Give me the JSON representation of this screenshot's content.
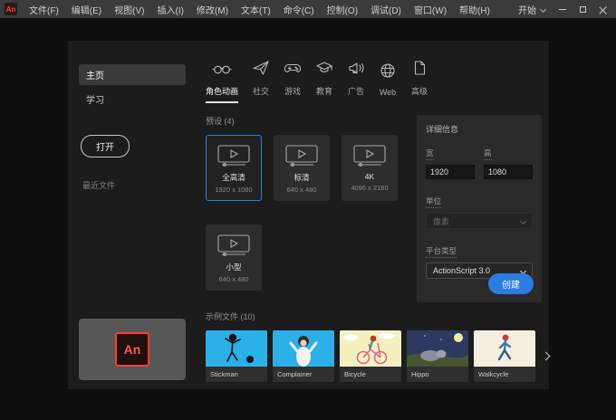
{
  "titlebar": {
    "app_icon_text": "An",
    "menus": [
      "文件(F)",
      "编辑(E)",
      "视图(V)",
      "插入(I)",
      "修改(M)",
      "文本(T)",
      "命令(C)",
      "控制(O)",
      "调试(D)",
      "窗口(W)",
      "帮助(H)"
    ],
    "workspace_label": "开始"
  },
  "sidebar": {
    "items": [
      {
        "label": "主页",
        "active": true
      },
      {
        "label": "学习",
        "active": false
      }
    ],
    "open_button_label": "打开",
    "recent_label": "最近文件",
    "logo_text": "An"
  },
  "tabs": [
    {
      "label": "角色动画",
      "icon": "character-animation-icon",
      "active": true
    },
    {
      "label": "社交",
      "icon": "paper-plane-icon",
      "active": false
    },
    {
      "label": "游戏",
      "icon": "gamepad-icon",
      "active": false
    },
    {
      "label": "教育",
      "icon": "graduation-cap-icon",
      "active": false
    },
    {
      "label": "广告",
      "icon": "megaphone-icon",
      "active": false
    },
    {
      "label": "Web",
      "icon": "globe-icon",
      "active": false
    },
    {
      "label": "高级",
      "icon": "document-icon",
      "active": false
    }
  ],
  "presets": {
    "header": "预设 (4)",
    "cards": [
      {
        "name": "全高清",
        "dims": "1920 x 1080",
        "selected": true
      },
      {
        "name": "标清",
        "dims": "640 x 480",
        "selected": false
      },
      {
        "name": "4K",
        "dims": "4096 x 2160",
        "selected": false
      },
      {
        "name": "小型",
        "dims": "640 x 480",
        "selected": false
      }
    ]
  },
  "details": {
    "header": "详细信息",
    "width_label": "宽",
    "width_value": "1920",
    "height_label": "高",
    "height_value": "1080",
    "units_label": "单位",
    "units_value": "像素",
    "platform_label": "平台类型",
    "platform_value": "ActionScript 3.0",
    "create_button_label": "创建"
  },
  "samples": {
    "header": "示例文件 (10)",
    "items": [
      {
        "label": "Stickman"
      },
      {
        "label": "Complainer"
      },
      {
        "label": "Bicycle"
      },
      {
        "label": "Hippo"
      },
      {
        "label": "Walkcycle"
      }
    ]
  },
  "colors": {
    "accent_blue": "#2a7de1",
    "selection_border": "#2f7fe0",
    "logo_red": "#ff3d2e",
    "menubar_bg": "#3b3b3b",
    "panel_bg": "#1c1c1c",
    "details_bg": "#2a2a2a"
  }
}
